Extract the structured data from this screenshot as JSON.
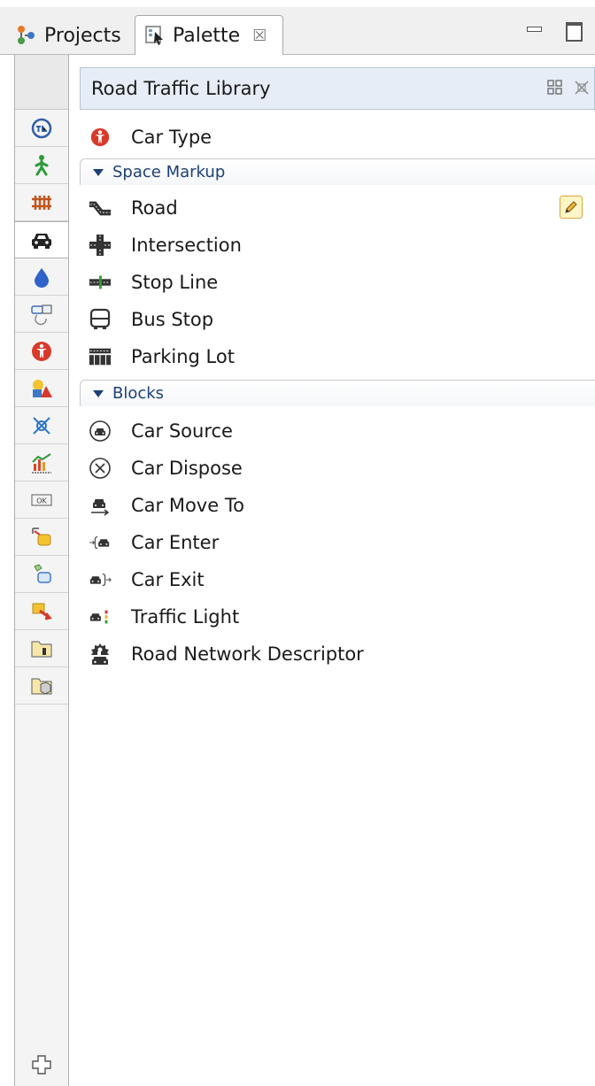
{
  "tabs": {
    "projects_label": "Projects",
    "palette_label": "Palette",
    "close_glyph": "☒"
  },
  "panel": {
    "title": "Road Traffic Library"
  },
  "items": {
    "car_type": "Car Type"
  },
  "sections": {
    "space_markup": {
      "title": "Space Markup",
      "items": [
        "Road",
        "Intersection",
        "Stop Line",
        "Bus Stop",
        "Parking Lot"
      ]
    },
    "blocks": {
      "title": "Blocks",
      "items": [
        "Car Source",
        "Car Dispose",
        "Car Move To",
        "Car Enter",
        "Car Exit",
        "Traffic Light",
        "Road Network Descriptor"
      ]
    }
  },
  "colors": {
    "accent_blue": "#1d3f78",
    "header_bg": "#e6edf6",
    "car_type_red": "#d83a2a"
  },
  "rail_icons": [
    "process-icon",
    "pedestrian-icon",
    "rail-icon",
    "car-icon",
    "fluid-icon",
    "material-icon",
    "car-type-icon",
    "presentation-icon",
    "connectivity-icon",
    "analysis-icon",
    "controls-icon",
    "pictures-icon",
    "3d-objects-icon",
    "agent-icon",
    "folder-icon",
    "folder-3d-icon"
  ]
}
